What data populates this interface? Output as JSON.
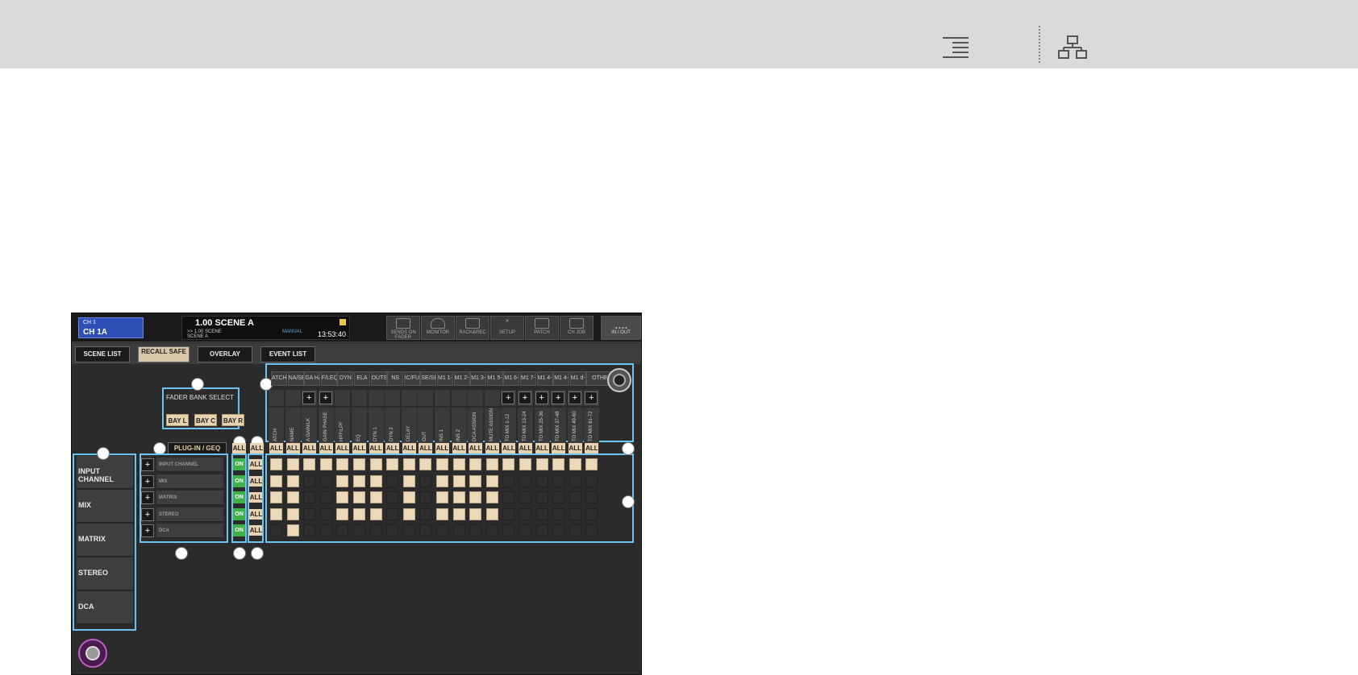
{
  "header": {
    "menu_icon": "menu-icon",
    "tree_icon": "hierarchy-icon"
  },
  "console": {
    "channel": {
      "line1": "CH 1",
      "line2": "CH 1A"
    },
    "scene": {
      "number_title": "1.00  SCENE A",
      "sub1": ">> 1.00    SCENE",
      "sub2": "SCENE A",
      "mode": "MANUAL",
      "time": "13:53:40"
    },
    "buttons": [
      "SENDS ON FADER",
      "MONITOR",
      "RACK&REC",
      "SETUP",
      "PATCH",
      "CH JOB",
      "IN / OUT"
    ],
    "tabs": [
      "SCENE LIST",
      "RECALL SAFE",
      "OVERLAY",
      "EVENT LIST"
    ],
    "fader_bank_title": "FADER BANK SELECT",
    "bays": [
      "BAY L",
      "BAY C",
      "BAY R"
    ],
    "plugin_label": "PLUG-IN / GEQ",
    "left_items": [
      "INPUT CHANNEL",
      "MIX",
      "MATRIX",
      "STEREO",
      "DCA"
    ],
    "rows": [
      "INPUT CHANNEL",
      "MIX",
      "MATRIX",
      "STEREO",
      "DCA"
    ],
    "on_label": "ON",
    "all_label": "ALL",
    "categories": [
      "ATCH",
      "NA/SE",
      "GA HA",
      "F/LEQ",
      "DYN",
      "ELA",
      "OUTS",
      "NS",
      "IC/FUT",
      "SE/SE",
      "M1 1-3",
      "M1 2-5",
      "M1 3-5",
      "M1 5-9",
      "M1 6-1",
      "M1 7-1",
      "M1 4-1",
      "M1 4-1",
      "M1 d-2",
      "OTHER"
    ],
    "column_headers": [
      "ATCH",
      "NAME",
      "A GAIN/LK",
      "GAIN PHASE",
      "HPF/LPF",
      "EQ",
      "DYN 1",
      "DYN 2",
      "DELAY",
      "OUT",
      "INS 1",
      "INS 2",
      "DCA ASSIGN",
      "MUTE ASSIGN",
      "TO MIX 1-12",
      "TO MIX 13-24",
      "TO MIX 25-36",
      "TO MIX 37-48",
      "TO MIX 49-60",
      "TO MIX 61-72"
    ],
    "grid": [
      [
        1,
        1,
        1,
        1,
        1,
        1,
        1,
        1,
        1,
        1,
        1,
        1,
        1,
        1,
        1,
        1,
        1,
        1,
        1,
        1
      ],
      [
        1,
        1,
        0,
        0,
        1,
        1,
        1,
        0,
        1,
        0,
        1,
        1,
        1,
        1,
        0,
        0,
        0,
        0,
        0,
        0
      ],
      [
        1,
        1,
        0,
        0,
        1,
        1,
        1,
        0,
        1,
        0,
        1,
        1,
        1,
        1,
        0,
        0,
        0,
        0,
        0,
        0
      ],
      [
        1,
        1,
        0,
        0,
        1,
        1,
        1,
        0,
        1,
        0,
        1,
        1,
        1,
        1,
        0,
        0,
        0,
        0,
        0,
        0
      ],
      [
        0,
        1,
        0,
        0,
        0,
        0,
        0,
        0,
        0,
        0,
        0,
        0,
        0,
        0,
        0,
        0,
        0,
        0,
        0,
        0
      ]
    ],
    "colors": {
      "accent": "#6cc4f2",
      "on_green": "#3fb04a",
      "cell_on": "#ecd9ba",
      "channel_blue": "#2f4fb8"
    }
  }
}
